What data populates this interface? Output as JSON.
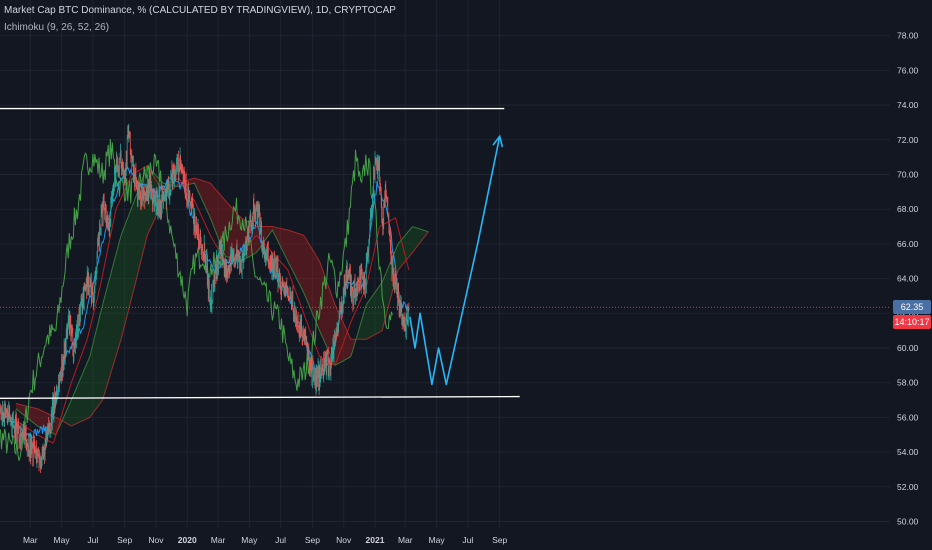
{
  "header": {
    "title": "Market Cap BTC Dominance, % (CALCULATED BY TRADINGVIEW), 1D, CRYPTOCAP",
    "indicator": "Ichimoku (9, 26, 52, 26)"
  },
  "price_tag": {
    "value": "62.35",
    "countdown": "14:10:17"
  },
  "colors": {
    "background": "#131722",
    "grid": "#1f2431",
    "axis_text": "#d1d4dc",
    "candle_up": "#26a69a",
    "candle_down": "#ef5350",
    "tenkan": "#2196f3",
    "kijun": "#b71c1c",
    "chikou": "#43a047",
    "cloud_bull": "#1b5e20",
    "cloud_bear": "#b71c1c",
    "channel": "#ffffff",
    "projection": "#29b6f6",
    "price_line": "#ef5350",
    "tag_blue": "#4a6fa5",
    "tag_red": "#f23645"
  },
  "chart_data": {
    "type": "candlestick",
    "title": "Market Cap BTC Dominance, % (CALCULATED BY TRADINGVIEW), 1D, CRYPTOCAP",
    "ylabel": "%",
    "ylim": [
      49.5,
      79
    ],
    "y_ticks": [
      "50.00",
      "52.00",
      "54.00",
      "56.00",
      "58.00",
      "60.00",
      "62.00",
      "64.00",
      "66.00",
      "68.00",
      "70.00",
      "72.00",
      "74.00",
      "76.00",
      "78.00"
    ],
    "x_ticks": [
      "Mar",
      "May",
      "Jul",
      "Sep",
      "Nov",
      "2020",
      "Mar",
      "May",
      "Jul",
      "Sep",
      "Nov",
      "2021",
      "Mar",
      "May",
      "Jul",
      "Sep"
    ],
    "x_ticks_bold": [
      "2020",
      "2021"
    ],
    "last_value": 62.35,
    "price_anchors": [
      [
        "2019-01-01",
        56.6
      ],
      [
        "2019-02-01",
        55.5
      ],
      [
        "2019-03-05",
        54.2
      ],
      [
        "2019-03-25",
        53.5
      ],
      [
        "2019-04-10",
        55.8
      ],
      [
        "2019-04-25",
        58.0
      ],
      [
        "2019-05-05",
        59.5
      ],
      [
        "2019-05-15",
        61.5
      ],
      [
        "2019-05-25",
        60.0
      ],
      [
        "2019-06-05",
        62.0
      ],
      [
        "2019-06-20",
        64.0
      ],
      [
        "2019-07-02",
        63.0
      ],
      [
        "2019-07-12",
        66.0
      ],
      [
        "2019-07-22",
        68.5
      ],
      [
        "2019-08-01",
        67.0
      ],
      [
        "2019-08-12",
        70.0
      ],
      [
        "2019-08-25",
        70.8
      ],
      [
        "2019-09-02",
        70.2
      ],
      [
        "2019-09-08",
        72.5
      ],
      [
        "2019-09-16",
        70.5
      ],
      [
        "2019-09-26",
        69.0
      ],
      [
        "2019-10-08",
        68.5
      ],
      [
        "2019-10-20",
        69.5
      ],
      [
        "2019-10-28",
        68.5
      ],
      [
        "2019-11-10",
        68.4
      ],
      [
        "2019-11-25",
        69.0
      ],
      [
        "2019-12-05",
        70.2
      ],
      [
        "2019-12-18",
        70.5
      ],
      [
        "2019-12-30",
        69.0
      ],
      [
        "2020-01-10",
        68.0
      ],
      [
        "2020-01-22",
        66.5
      ],
      [
        "2020-02-05",
        65.5
      ],
      [
        "2020-02-15",
        62.5
      ],
      [
        "2020-02-25",
        64.5
      ],
      [
        "2020-03-05",
        65.5
      ],
      [
        "2020-03-15",
        64.5
      ],
      [
        "2020-03-25",
        65.0
      ],
      [
        "2020-04-05",
        65.5
      ],
      [
        "2020-04-15",
        64.8
      ],
      [
        "2020-04-28",
        66.5
      ],
      [
        "2020-05-10",
        68.0
      ],
      [
        "2020-05-20",
        67.5
      ],
      [
        "2020-05-28",
        65.5
      ],
      [
        "2020-06-08",
        65.0
      ],
      [
        "2020-06-22",
        64.5
      ],
      [
        "2020-07-05",
        63.5
      ],
      [
        "2020-07-20",
        63.0
      ],
      [
        "2020-08-01",
        61.5
      ],
      [
        "2020-08-12",
        61.0
      ],
      [
        "2020-08-25",
        59.5
      ],
      [
        "2020-09-05",
        58.0
      ],
      [
        "2020-09-15",
        58.5
      ],
      [
        "2020-09-25",
        59.2
      ],
      [
        "2020-10-05",
        59.0
      ],
      [
        "2020-10-15",
        60.5
      ],
      [
        "2020-10-28",
        62.5
      ],
      [
        "2020-11-08",
        64.5
      ],
      [
        "2020-11-20",
        63.0
      ],
      [
        "2020-12-01",
        64.0
      ],
      [
        "2020-12-12",
        63.5
      ],
      [
        "2020-12-22",
        67.0
      ],
      [
        "2021-01-02",
        71.0
      ],
      [
        "2021-01-10",
        70.0
      ],
      [
        "2021-01-16",
        67.0
      ],
      [
        "2021-01-22",
        69.5
      ],
      [
        "2021-02-02",
        65.0
      ],
      [
        "2021-02-10",
        63.5
      ],
      [
        "2021-02-20",
        62.5
      ],
      [
        "2021-02-28",
        61.0
      ],
      [
        "2021-03-08",
        62.35
      ]
    ],
    "ichimoku": {
      "tenkan": [
        [
          "2019-01-12",
          56.0
        ],
        [
          "2019-03-01",
          55.0
        ],
        [
          "2019-04-10",
          55.5
        ],
        [
          "2019-05-10",
          59.5
        ],
        [
          "2019-06-15",
          61.5
        ],
        [
          "2019-07-15",
          65.5
        ],
        [
          "2019-08-10",
          68.5
        ],
        [
          "2019-09-05",
          70.5
        ],
        [
          "2019-10-01",
          69.5
        ],
        [
          "2019-11-01",
          68.8
        ],
        [
          "2019-12-01",
          69.8
        ],
        [
          "2019-12-25",
          69.2
        ],
        [
          "2020-01-25",
          66.0
        ],
        [
          "2020-02-25",
          64.5
        ],
        [
          "2020-03-25",
          65.0
        ],
        [
          "2020-04-25",
          66.0
        ],
        [
          "2020-05-15",
          67.2
        ],
        [
          "2020-06-10",
          64.5
        ],
        [
          "2020-07-10",
          63.5
        ],
        [
          "2020-08-10",
          61.0
        ],
        [
          "2020-09-10",
          58.5
        ],
        [
          "2020-10-10",
          59.5
        ],
        [
          "2020-11-05",
          63.5
        ],
        [
          "2020-12-10",
          63.8
        ],
        [
          "2021-01-05",
          69.5
        ],
        [
          "2021-01-25",
          68.0
        ],
        [
          "2021-02-20",
          62.5
        ],
        [
          "2021-03-08",
          62.3
        ]
      ],
      "kijun": [
        [
          "2019-01-12",
          56.2
        ],
        [
          "2019-03-15",
          55.0
        ],
        [
          "2019-04-15",
          54.5
        ],
        [
          "2019-05-20",
          58.0
        ],
        [
          "2019-06-20",
          60.5
        ],
        [
          "2019-07-15",
          63.5
        ],
        [
          "2019-08-15",
          68.0
        ],
        [
          "2019-09-15",
          70.0
        ],
        [
          "2019-10-15",
          70.5
        ],
        [
          "2019-11-15",
          69.0
        ],
        [
          "2019-12-15",
          69.8
        ],
        [
          "2020-01-15",
          68.5
        ],
        [
          "2020-02-15",
          66.5
        ],
        [
          "2020-03-15",
          65.0
        ],
        [
          "2020-04-15",
          65.5
        ],
        [
          "2020-05-15",
          66.5
        ],
        [
          "2020-06-15",
          65.5
        ],
        [
          "2020-07-15",
          64.5
        ],
        [
          "2020-08-15",
          62.0
        ],
        [
          "2020-09-15",
          59.5
        ],
        [
          "2020-10-15",
          59.0
        ],
        [
          "2020-11-15",
          61.5
        ],
        [
          "2020-12-15",
          63.5
        ],
        [
          "2021-01-10",
          67.0
        ],
        [
          "2021-02-10",
          67.5
        ],
        [
          "2021-03-08",
          64.5
        ]
      ],
      "chikou": [
        [
          "2018-12-01",
          56.0
        ],
        [
          "2019-01-15",
          54.5
        ],
        [
          "2019-02-10",
          54.0
        ],
        [
          "2019-03-01",
          57.5
        ],
        [
          "2019-04-01",
          60.5
        ],
        [
          "2019-04-20",
          61.0
        ],
        [
          "2019-05-15",
          66.0
        ],
        [
          "2019-06-01",
          68.0
        ],
        [
          "2019-06-15",
          70.5
        ],
        [
          "2019-07-01",
          71.0
        ],
        [
          "2019-07-20",
          70.0
        ],
        [
          "2019-08-05",
          71.5
        ],
        [
          "2019-08-20",
          69.5
        ],
        [
          "2019-09-10",
          69.0
        ],
        [
          "2019-10-01",
          69.5
        ],
        [
          "2019-10-25",
          70.5
        ],
        [
          "2019-11-10",
          70.0
        ],
        [
          "2019-12-05",
          66.0
        ],
        [
          "2020-01-01",
          62.5
        ],
        [
          "2020-01-15",
          65.0
        ],
        [
          "2020-02-01",
          65.5
        ],
        [
          "2020-02-15",
          64.5
        ],
        [
          "2020-03-01",
          65.0
        ],
        [
          "2020-04-01",
          68.0
        ],
        [
          "2020-04-20",
          67.5
        ],
        [
          "2020-05-10",
          64.5
        ],
        [
          "2020-05-25",
          63.5
        ],
        [
          "2020-06-10",
          62.5
        ],
        [
          "2020-07-01",
          61.5
        ],
        [
          "2020-07-15",
          59.5
        ],
        [
          "2020-08-01",
          58.0
        ],
        [
          "2020-08-15",
          58.5
        ],
        [
          "2020-09-01",
          60.0
        ],
        [
          "2020-09-15",
          62.5
        ],
        [
          "2020-10-05",
          65.0
        ],
        [
          "2020-10-20",
          63.5
        ],
        [
          "2020-11-05",
          66.0
        ],
        [
          "2020-11-25",
          71.0
        ],
        [
          "2020-12-05",
          69.0
        ],
        [
          "2020-12-15",
          71.0
        ],
        [
          "2020-12-28",
          69.0
        ],
        [
          "2021-01-10",
          65.0
        ],
        [
          "2021-01-20",
          62.0
        ],
        [
          "2021-02-05",
          61.5
        ]
      ],
      "span_a": [
        [
          "2019-02-01",
          56.5
        ],
        [
          "2019-03-15",
          55.5
        ],
        [
          "2019-04-20",
          55.0
        ],
        [
          "2019-05-20",
          57.0
        ],
        [
          "2019-06-25",
          59.5
        ],
        [
          "2019-07-20",
          62.5
        ],
        [
          "2019-08-25",
          66.5
        ],
        [
          "2019-09-20",
          68.5
        ],
        [
          "2019-10-15",
          70.5
        ],
        [
          "2019-11-15",
          69.5
        ],
        [
          "2019-12-15",
          69.3
        ],
        [
          "2020-01-15",
          69.5
        ],
        [
          "2020-02-15",
          67.5
        ],
        [
          "2020-03-15",
          65.3
        ],
        [
          "2020-04-15",
          65.0
        ],
        [
          "2020-05-15",
          65.5
        ],
        [
          "2020-06-15",
          66.8
        ],
        [
          "2020-07-15",
          65.0
        ],
        [
          "2020-08-15",
          63.2
        ],
        [
          "2020-09-15",
          61.0
        ],
        [
          "2020-10-15",
          59.0
        ],
        [
          "2020-11-15",
          59.5
        ],
        [
          "2020-12-15",
          62.5
        ],
        [
          "2021-01-15",
          63.8
        ],
        [
          "2021-02-15",
          66.0
        ],
        [
          "2021-03-15",
          67.0
        ],
        [
          "2021-04-15",
          66.7
        ]
      ],
      "span_b": [
        [
          "2019-02-01",
          56.8
        ],
        [
          "2019-03-15",
          56.5
        ],
        [
          "2019-04-20",
          56.0
        ],
        [
          "2019-05-20",
          55.5
        ],
        [
          "2019-06-25",
          56.0
        ],
        [
          "2019-07-20",
          57.0
        ],
        [
          "2019-08-25",
          60.5
        ],
        [
          "2019-09-20",
          63.5
        ],
        [
          "2019-10-15",
          66.5
        ],
        [
          "2019-11-15",
          68.5
        ],
        [
          "2019-12-15",
          69.5
        ],
        [
          "2020-01-15",
          69.8
        ],
        [
          "2020-02-15",
          69.5
        ],
        [
          "2020-03-15",
          68.5
        ],
        [
          "2020-04-15",
          67.5
        ],
        [
          "2020-05-15",
          67.0
        ],
        [
          "2020-06-15",
          67.0
        ],
        [
          "2020-07-15",
          66.8
        ],
        [
          "2020-08-15",
          66.5
        ],
        [
          "2020-09-15",
          65.0
        ],
        [
          "2020-10-15",
          62.5
        ],
        [
          "2020-11-15",
          60.5
        ],
        [
          "2020-12-15",
          60.5
        ],
        [
          "2021-01-15",
          61.0
        ],
        [
          "2021-02-15",
          64.5
        ],
        [
          "2021-03-15",
          65.5
        ],
        [
          "2021-04-15",
          66.7
        ]
      ]
    },
    "drawings": {
      "channel_upper": [
        [
          "2018-12-20",
          73.8
        ],
        [
          "2021-09-10",
          73.8
        ]
      ],
      "channel_lower": [
        [
          "2018-12-20",
          57.1
        ],
        [
          "2021-10-10",
          57.2
        ]
      ],
      "projection": [
        [
          "2021-03-10",
          61.8
        ],
        [
          "2021-03-20",
          60.0
        ],
        [
          "2021-03-30",
          62.0
        ],
        [
          "2021-04-22",
          57.9
        ],
        [
          "2021-05-05",
          60.0
        ],
        [
          "2021-05-20",
          57.9
        ],
        [
          "2021-07-20",
          66.0
        ],
        [
          "2021-09-01",
          72.2
        ]
      ]
    }
  }
}
